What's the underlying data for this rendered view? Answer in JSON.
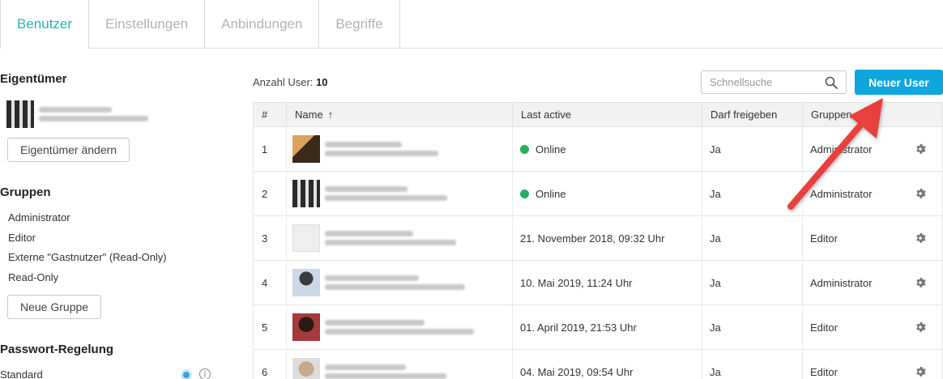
{
  "tabs": [
    {
      "label": "Benutzer",
      "active": true
    },
    {
      "label": "Einstellungen",
      "active": false
    },
    {
      "label": "Anbindungen",
      "active": false
    },
    {
      "label": "Begriffe",
      "active": false
    }
  ],
  "sidebar": {
    "owner_title": "Eigentümer",
    "change_owner_label": "Eigentümer ändern",
    "groups_title": "Gruppen",
    "groups": [
      "Administrator",
      "Editor",
      "Externe \"Gastnutzer\" (Read-Only)",
      "Read-Only"
    ],
    "new_group_label": "Neue Gruppe",
    "password_title": "Passwort-Regelung",
    "password_option": "Standard"
  },
  "main": {
    "count_label": "Anzahl User:",
    "count_value": "10",
    "search_placeholder": "Schnellsuche",
    "new_user_label": "Neuer User"
  },
  "table": {
    "headers": {
      "num": "#",
      "name": "Name",
      "sort_icon": "↑",
      "last_active": "Last active",
      "share": "Darf freigeben",
      "groups": "Gruppen"
    },
    "rows": [
      {
        "num": "1",
        "last_active": "Online",
        "online": true,
        "share": "Ja",
        "group": "Administrator"
      },
      {
        "num": "2",
        "last_active": "Online",
        "online": true,
        "share": "Ja",
        "group": "Administrator"
      },
      {
        "num": "3",
        "last_active": "21. November 2018, 09:32 Uhr",
        "online": false,
        "share": "Ja",
        "group": "Editor"
      },
      {
        "num": "4",
        "last_active": "10. Mai 2019, 11:24 Uhr",
        "online": false,
        "share": "Ja",
        "group": "Administrator"
      },
      {
        "num": "5",
        "last_active": "01. April 2019, 21:53 Uhr",
        "online": false,
        "share": "Ja",
        "group": "Editor"
      },
      {
        "num": "6",
        "last_active": "04. Mai 2019, 09:54 Uhr",
        "online": false,
        "share": "Ja",
        "group": "Editor"
      }
    ]
  },
  "colors": {
    "accent": "#2bb3b1",
    "primary": "#0ea7dd",
    "online": "#27ae60",
    "arrow": "#e8413c"
  }
}
